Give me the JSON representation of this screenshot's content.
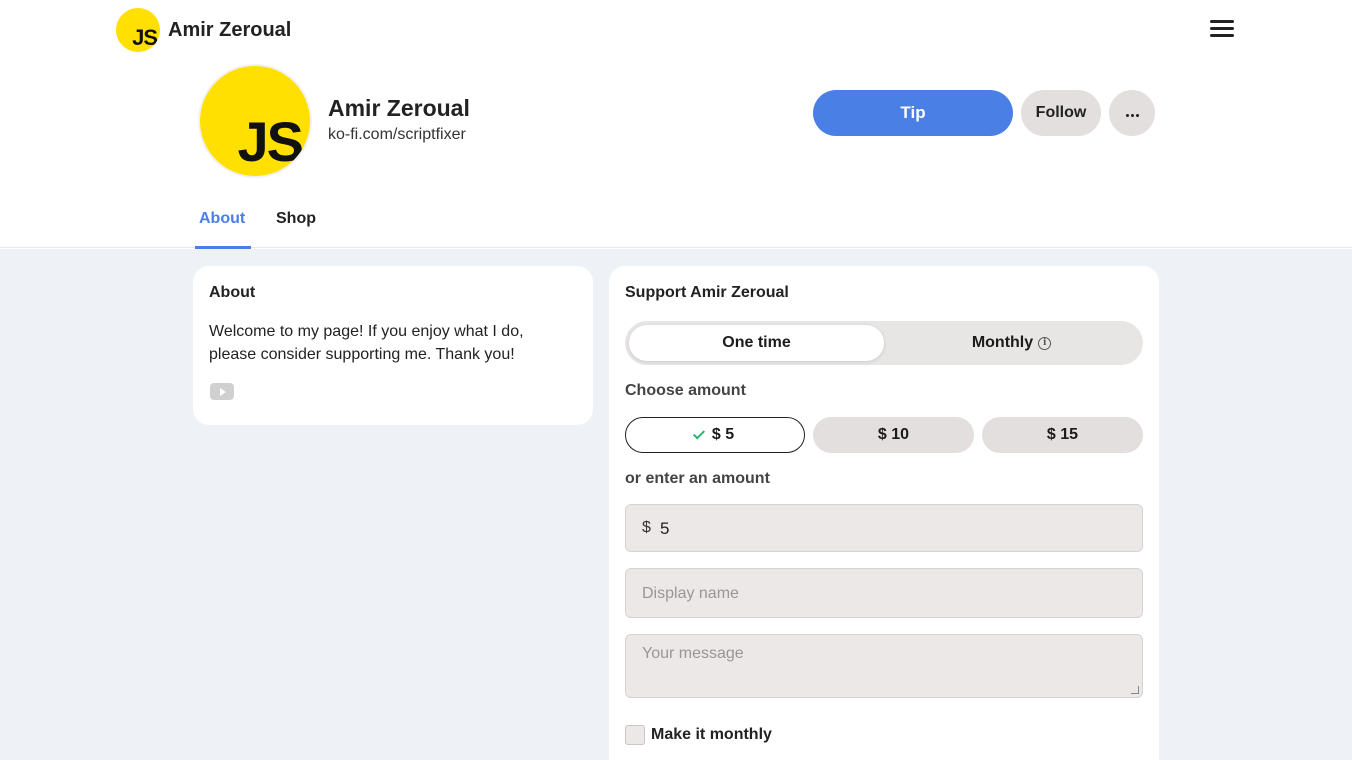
{
  "brand": {
    "logo_text": "JS",
    "name": "Amir Zeroual"
  },
  "nav": {
    "menu_icon": "hamburger-menu-icon"
  },
  "profile": {
    "avatar_text": "JS",
    "name": "Amir Zeroual",
    "url": "ko-fi.com/scriptfixer",
    "tip_label": "Tip",
    "follow_label": "Follow",
    "more_icon": "more-horizontal-icon"
  },
  "tabs": [
    {
      "label": "About",
      "active": true
    },
    {
      "label": "Shop",
      "active": false
    }
  ],
  "about": {
    "title": "About",
    "text": "Welcome to my page! If you enjoy what I do, please consider supporting me. Thank you!",
    "social_icon": "youtube-icon"
  },
  "support": {
    "title": "Support Amir Zeroual",
    "frequency": {
      "one_time": "One time",
      "monthly": "Monthly",
      "selected": "One time"
    },
    "choose_label": "Choose amount",
    "amounts": [
      {
        "label": "$ 5",
        "selected": true
      },
      {
        "label": "$ 10",
        "selected": false
      },
      {
        "label": "$ 15",
        "selected": false
      }
    ],
    "enter_label": "or enter an amount",
    "currency_symbol": "$",
    "amount_value": "5",
    "display_name_placeholder": "Display name",
    "message_placeholder": "Your message",
    "monthly_checkbox_label": "Make it monthly",
    "monthly_checked": false
  },
  "colors": {
    "accent": "#4a7fe6",
    "logo_yellow": "#ffe000",
    "page_background": "#eef1f6",
    "check_green": "#2eb36b"
  }
}
